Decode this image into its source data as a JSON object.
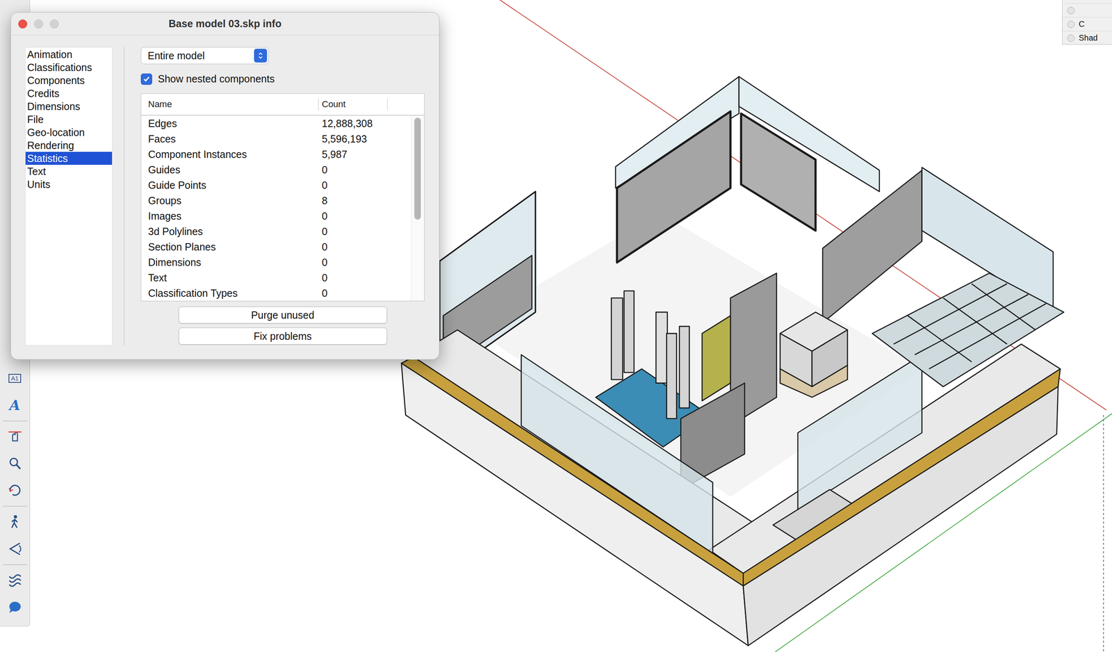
{
  "window": {
    "title": "Base model 03.skp info"
  },
  "sidebar": {
    "items": [
      {
        "label": "Animation",
        "selected": false
      },
      {
        "label": "Classifications",
        "selected": false
      },
      {
        "label": "Components",
        "selected": false
      },
      {
        "label": "Credits",
        "selected": false
      },
      {
        "label": "Dimensions",
        "selected": false
      },
      {
        "label": "File",
        "selected": false
      },
      {
        "label": "Geo-location",
        "selected": false
      },
      {
        "label": "Rendering",
        "selected": false
      },
      {
        "label": "Statistics",
        "selected": true
      },
      {
        "label": "Text",
        "selected": false
      },
      {
        "label": "Units",
        "selected": false
      }
    ]
  },
  "scope_dropdown": {
    "value": "Entire model"
  },
  "nested_checkbox": {
    "label": "Show nested components",
    "checked": true
  },
  "table": {
    "columns": [
      "Name",
      "Count"
    ],
    "rows": [
      [
        "Edges",
        "12,888,308"
      ],
      [
        "Faces",
        "5,596,193"
      ],
      [
        "Component Instances",
        "5,987"
      ],
      [
        "Guides",
        "0"
      ],
      [
        "Guide Points",
        "0"
      ],
      [
        "Groups",
        "8"
      ],
      [
        "Images",
        "0"
      ],
      [
        "3d Polylines",
        "0"
      ],
      [
        "Section Planes",
        "0"
      ],
      [
        "Dimensions",
        "0"
      ],
      [
        "Text",
        "0"
      ],
      [
        "Classification Types",
        "0"
      ]
    ],
    "scrollbar": {
      "position": 0,
      "visible_share": 0.55
    }
  },
  "buttons": [
    "Purge unused",
    "Fix problems"
  ],
  "toolbar": {
    "groups": [
      [
        {
          "kind": "label",
          "glyph": "A1"
        },
        {
          "kind": "text3d",
          "glyph": "A"
        }
      ],
      [
        {
          "kind": "move"
        },
        {
          "kind": "zoom"
        },
        {
          "kind": "orbit"
        }
      ],
      [
        {
          "kind": "walk"
        },
        {
          "kind": "look"
        }
      ],
      [
        {
          "kind": "section"
        },
        {
          "kind": "message"
        }
      ]
    ]
  },
  "tray_panel": {
    "items": [
      {
        "label": ""
      },
      {
        "label": "C"
      },
      {
        "label": "Shad"
      }
    ]
  }
}
